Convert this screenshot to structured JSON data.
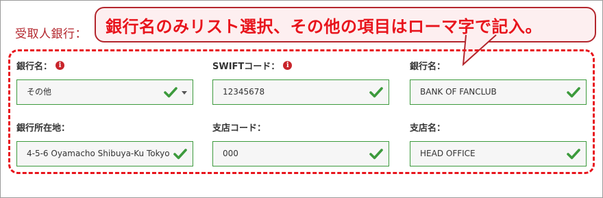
{
  "section": {
    "title": "受取人銀行："
  },
  "callout": {
    "text": "銀行名のみリスト選択、その他の項目はローマ字で記入。"
  },
  "fields": [
    {
      "label": "銀行名：",
      "value": "その他",
      "info": true,
      "dropdown": true
    },
    {
      "label": "SWIFTコード：",
      "value": "12345678",
      "info": true,
      "dropdown": false
    },
    {
      "label": "銀行名：",
      "value": "BANK OF FANCLUB",
      "info": false,
      "dropdown": false
    },
    {
      "label": "銀行所在地：",
      "value": "4-5-6 Oyamacho Shibuya-Ku Tokyo",
      "info": false,
      "dropdown": false
    },
    {
      "label": "支店コード：",
      "value": "000",
      "info": false,
      "dropdown": false
    },
    {
      "label": "支店名：",
      "value": "HEAD OFFICE",
      "info": false,
      "dropdown": false
    }
  ],
  "icons": {
    "info": "info-icon",
    "valid": "check-icon",
    "dropdown": "caret-down-icon"
  },
  "info_glyph": "i",
  "colors": {
    "valid_border": "#3c9a3c",
    "check": "#3c9a3c",
    "accent_red": "#e8141c",
    "info": "#c8242b",
    "title": "#b3262d"
  }
}
